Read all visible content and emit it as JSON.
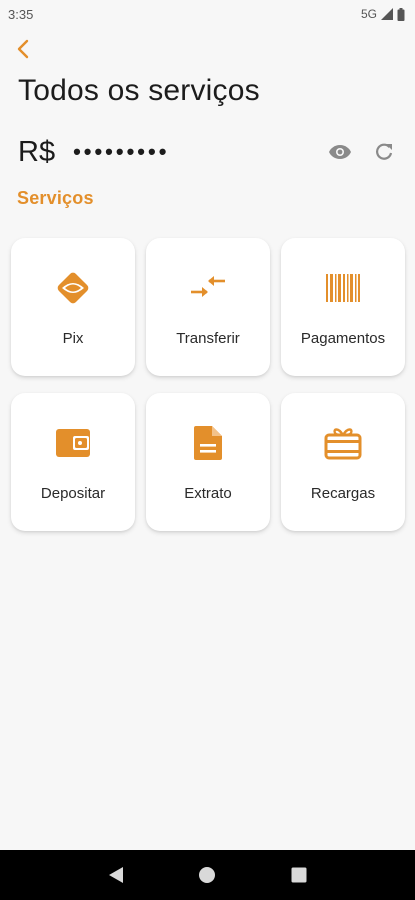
{
  "status_bar": {
    "time": "3:35",
    "network": "5G"
  },
  "header": {
    "title": "Todos os serviços"
  },
  "balance": {
    "currency": "R$",
    "masked_value": "•••••••••"
  },
  "section": {
    "title": "Serviços"
  },
  "services": [
    {
      "label": "Pix",
      "icon": "pix-icon"
    },
    {
      "label": "Transferir",
      "icon": "transfer-icon"
    },
    {
      "label": "Pagamentos",
      "icon": "barcode-icon"
    },
    {
      "label": "Depositar",
      "icon": "wallet-icon"
    },
    {
      "label": "Extrato",
      "icon": "document-icon"
    },
    {
      "label": "Recargas",
      "icon": "gift-card-icon"
    }
  ],
  "colors": {
    "accent": "#e38f2b",
    "background": "#f7f7f7",
    "card": "#ffffff",
    "nav": "#000000"
  }
}
